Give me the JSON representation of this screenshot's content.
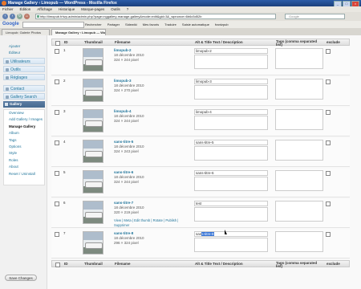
{
  "window": {
    "title": "Manage Gallery ‹ Limopub — WordPress - Mozilla Firefox",
    "controls": [
      "_",
      "□",
      "×"
    ]
  },
  "menubar": [
    "Fichier",
    "Édition",
    "Affichage",
    "Historique",
    "Marque-pages",
    "Outils",
    "?"
  ],
  "nav": {
    "url": "http://limopub.fr/wp-admin/admin.php?page=nggallery-manage-gallery&mode=edit&gid=3&_wpnonce=6b6c5d52b",
    "search_placeholder": "Google"
  },
  "google_toolbar": {
    "logo": "Google",
    "items": [
      "Rechercher",
      "Partager",
      "Sidewiki",
      "Mes favoris",
      "Traduire",
      "Saisie automatique",
      "frantzpub"
    ]
  },
  "tabs": [
    {
      "label": "Limopub: Galerie Photos"
    },
    {
      "label": "Manage Gallery ‹ Limopub — Wor..."
    }
  ],
  "sidebar": {
    "items": [
      {
        "label": "Ajouter"
      },
      {
        "label": "Éditeur"
      },
      {
        "label": "Utilisateurs"
      },
      {
        "label": "Outils"
      },
      {
        "label": "Réglages"
      },
      {
        "label": "Contact"
      },
      {
        "label": "Gallery Search"
      },
      {
        "label": "Gallery"
      }
    ],
    "gallery_submenu": [
      "Overview",
      "Add Gallery / Images",
      "Manage Gallery",
      "Album",
      "Tags",
      "Options",
      "Style",
      "Roles",
      "About",
      "Reset / Uninstall"
    ]
  },
  "table": {
    "headers": {
      "id": "ID",
      "thumbnail": "Thumbnail",
      "filename": "Filename",
      "alt": "Alt & Title Text / Description",
      "tags": "Tags (comma separated list)",
      "exclude": "exclude"
    },
    "rows": [
      {
        "id": "1",
        "filename": "limopub-2",
        "date": "18 décembre 2010",
        "size": "324 × 244 pixel",
        "alt": "limopub-2"
      },
      {
        "id": "2",
        "filename": "limopub-3",
        "date": "18 décembre 2010",
        "size": "324 × 270 pixel",
        "alt": "limopub-3"
      },
      {
        "id": "3",
        "filename": "limopub-4",
        "date": "18 décembre 2010",
        "size": "324 × 244 pixel",
        "alt": "limopub-4"
      },
      {
        "id": "4",
        "filename": "sans-titre-5",
        "date": "18 décembre 2010",
        "size": "324 × 243 pixel",
        "alt": "sans-titre-5"
      },
      {
        "id": "5",
        "filename": "sans-titre-6",
        "date": "18 décembre 2010",
        "size": "324 × 244 pixel",
        "alt": "sans-titre-6"
      },
      {
        "id": "6",
        "filename": "sans-titre-7",
        "date": "18 décembre 2010",
        "size": "320 × 219 pixel",
        "alt": "test",
        "actions": "View | Meta | Edit thumb | Rotate | Publish | Supprimer"
      },
      {
        "id": "7",
        "filename": "sans-titre-8",
        "date": "18 décembre 2010",
        "size": "296 × 324 pixel",
        "alt": "sans-titre-8",
        "alt_prefix": "san",
        "alt_selected": "s-titre-8"
      }
    ]
  },
  "save_button": "Save Changes",
  "colors": {
    "link": "#21759b",
    "selection": "#3875d7",
    "wp_menu_active": "#466a90"
  }
}
